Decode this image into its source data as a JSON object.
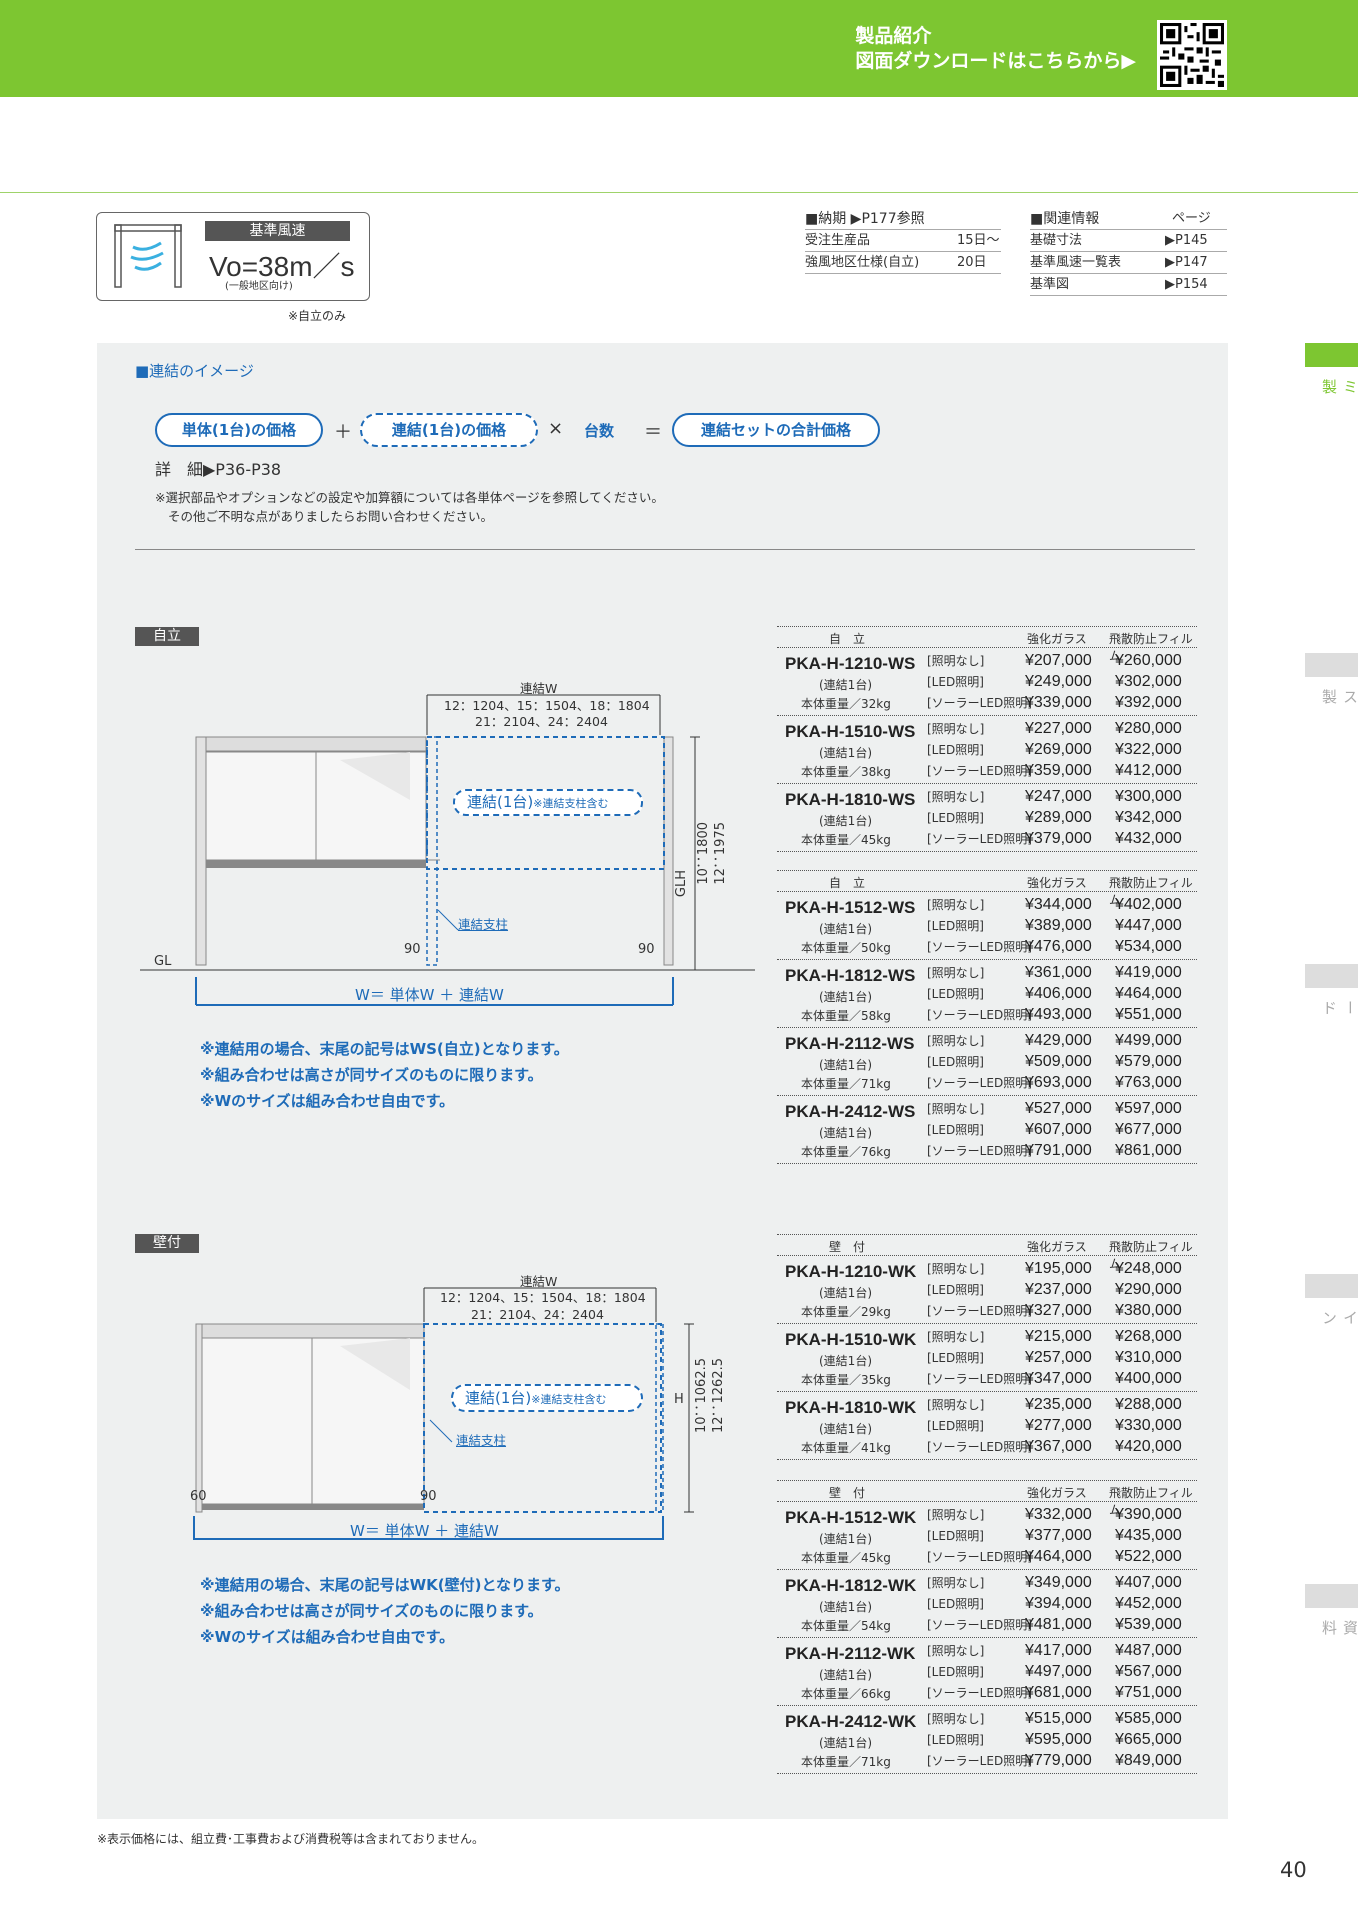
{
  "header": {
    "line1": "製品紹介",
    "line2": "図面ダウンロードはこちらから▶"
  },
  "wind": {
    "badge": "基準風速",
    "value": "Vo=38m／s",
    "sub": "(一般地区向け)",
    "note": "※自立のみ"
  },
  "delivery": {
    "title": "■納期 ▶P177参照",
    "rows": [
      {
        "k": "受注生産品",
        "v": "15日〜"
      },
      {
        "k": "強風地区仕様(自立)",
        "v": "20日"
      }
    ]
  },
  "related": {
    "title": "■関連情報",
    "page_label": "ページ",
    "rows": [
      {
        "k": "基礎寸法",
        "v": "▶P145"
      },
      {
        "k": "基準風速一覧表",
        "v": "▶P147"
      },
      {
        "k": "基準図",
        "v": "▶P154"
      }
    ]
  },
  "image_section": {
    "title": "■連結のイメージ",
    "pill1": "単体(1台)の価格",
    "plus": "＋",
    "pill2": "連結(1台)の価格",
    "times": "×",
    "count": "台数",
    "eq": "＝",
    "pill3": "連結セットの合計価格",
    "detail": "詳　細▶P36-P38",
    "note1": "※選択部品やオプションなどの設定や加算額については各単体ページを参照してください。",
    "note2": "その他ご不明な点がありましたらお問い合わせください。"
  },
  "jiritsu": {
    "tag": "自立",
    "renketsuw": "連結W",
    "dims1": "12：1204、15：1504、18：1804",
    "dims2": "21：2104、24：2404",
    "renketsu1": "連結(1台)",
    "renketsu1_sub": "※連結支柱含む",
    "pillar": "連結支柱",
    "gl": "GL",
    "d90a": "90",
    "d90b": "90",
    "glh": "GLH",
    "h1": "10：1800",
    "h2": "12：1975",
    "wlabel": "W＝ 単体W ＋ 連結W",
    "notes": [
      "※連結用の場合、末尾の記号はWS(自立)となります。",
      "※組み合わせは高さが同サイズのものに限ります。",
      "※Wのサイズは組み合わせ自由です。"
    ]
  },
  "kabetsuke": {
    "tag": "壁付",
    "renketsuw": "連結W",
    "dims1": "12：1204、15：1504、18：1804",
    "dims2": "21：2104、24：2404",
    "renketsu1": "連結(1台)",
    "renketsu1_sub": "※連結支柱含む",
    "pillar": "連結支柱",
    "d60": "60",
    "d90": "90",
    "hl": "H",
    "h1": "10：1062.5",
    "h2": "12：1262.5",
    "wlabel": "W＝ 単体W ＋ 連結W",
    "notes": [
      "※連結用の場合、末尾の記号はWK(壁付)となります。",
      "※組み合わせは高さが同サイズのものに限ります。",
      "※Wのサイズは組み合わせ自由です。"
    ]
  },
  "options": [
    "[照明なし]",
    "[LED照明]",
    "[ソーラーLED照明]"
  ],
  "sub": "(連結1台)",
  "tables": [
    {
      "head": "自　立",
      "c1": "強化ガラス",
      "c2": "飛散防止フィルム",
      "rows": [
        {
          "model": "PKA-H-1210-WS",
          "weight": "本体重量／32kg",
          "a": [
            "¥207,000",
            "¥249,000",
            "¥339,000"
          ],
          "b": [
            "¥260,000",
            "¥302,000",
            "¥392,000"
          ]
        },
        {
          "model": "PKA-H-1510-WS",
          "weight": "本体重量／38kg",
          "a": [
            "¥227,000",
            "¥269,000",
            "¥359,000"
          ],
          "b": [
            "¥280,000",
            "¥322,000",
            "¥412,000"
          ]
        },
        {
          "model": "PKA-H-1810-WS",
          "weight": "本体重量／45kg",
          "a": [
            "¥247,000",
            "¥289,000",
            "¥379,000"
          ],
          "b": [
            "¥300,000",
            "¥342,000",
            "¥432,000"
          ]
        }
      ]
    },
    {
      "head": "自　立",
      "c1": "強化ガラス",
      "c2": "飛散防止フィルム",
      "rows": [
        {
          "model": "PKA-H-1512-WS",
          "weight": "本体重量／50kg",
          "a": [
            "¥344,000",
            "¥389,000",
            "¥476,000"
          ],
          "b": [
            "¥402,000",
            "¥447,000",
            "¥534,000"
          ]
        },
        {
          "model": "PKA-H-1812-WS",
          "weight": "本体重量／58kg",
          "a": [
            "¥361,000",
            "¥406,000",
            "¥493,000"
          ],
          "b": [
            "¥419,000",
            "¥464,000",
            "¥551,000"
          ]
        },
        {
          "model": "PKA-H-2112-WS",
          "weight": "本体重量／71kg",
          "a": [
            "¥429,000",
            "¥509,000",
            "¥693,000"
          ],
          "b": [
            "¥499,000",
            "¥579,000",
            "¥763,000"
          ]
        },
        {
          "model": "PKA-H-2412-WS",
          "weight": "本体重量／76kg",
          "a": [
            "¥527,000",
            "¥607,000",
            "¥791,000"
          ],
          "b": [
            "¥597,000",
            "¥677,000",
            "¥861,000"
          ]
        }
      ]
    },
    {
      "head": "壁　付",
      "c1": "強化ガラス",
      "c2": "飛散防止フィルム",
      "rows": [
        {
          "model": "PKA-H-1210-WK",
          "weight": "本体重量／29kg",
          "a": [
            "¥195,000",
            "¥237,000",
            "¥327,000"
          ],
          "b": [
            "¥248,000",
            "¥290,000",
            "¥380,000"
          ]
        },
        {
          "model": "PKA-H-1510-WK",
          "weight": "本体重量／35kg",
          "a": [
            "¥215,000",
            "¥257,000",
            "¥347,000"
          ],
          "b": [
            "¥268,000",
            "¥310,000",
            "¥400,000"
          ]
        },
        {
          "model": "PKA-H-1810-WK",
          "weight": "本体重量／41kg",
          "a": [
            "¥235,000",
            "¥277,000",
            "¥367,000"
          ],
          "b": [
            "¥288,000",
            "¥330,000",
            "¥420,000"
          ]
        }
      ]
    },
    {
      "head": "壁　付",
      "c1": "強化ガラス",
      "c2": "飛散防止フィルム",
      "rows": [
        {
          "model": "PKA-H-1512-WK",
          "weight": "本体重量／45kg",
          "a": [
            "¥332,000",
            "¥377,000",
            "¥464,000"
          ],
          "b": [
            "¥390,000",
            "¥435,000",
            "¥522,000"
          ]
        },
        {
          "model": "PKA-H-1812-WK",
          "weight": "本体重量／54kg",
          "a": [
            "¥349,000",
            "¥394,000",
            "¥481,000"
          ],
          "b": [
            "¥407,000",
            "¥452,000",
            "¥539,000"
          ]
        },
        {
          "model": "PKA-H-2112-WK",
          "weight": "本体重量／66kg",
          "a": [
            "¥417,000",
            "¥497,000",
            "¥681,000"
          ],
          "b": [
            "¥487,000",
            "¥567,000",
            "¥751,000"
          ]
        },
        {
          "model": "PKA-H-2412-WK",
          "weight": "本体重量／71kg",
          "a": [
            "¥515,000",
            "¥595,000",
            "¥779,000"
          ],
          "b": [
            "¥585,000",
            "¥665,000",
            "¥849,000"
          ]
        }
      ]
    }
  ],
  "sidebar": [
    {
      "label": "ポステージ／アルミ製",
      "active": true
    },
    {
      "label": "ポステージ／ステンレス製",
      "active": false
    },
    {
      "label": "サインボード",
      "active": false
    },
    {
      "label": "内照式サイン",
      "active": false
    },
    {
      "label": "参考資料",
      "active": false
    }
  ],
  "footer": "※表示価格には、組立費･工事費および消費税等は含まれておりません。",
  "page_number": "40",
  "colors": {
    "brand_green": "#7dc631",
    "accent_blue": "#1e6bb8"
  }
}
